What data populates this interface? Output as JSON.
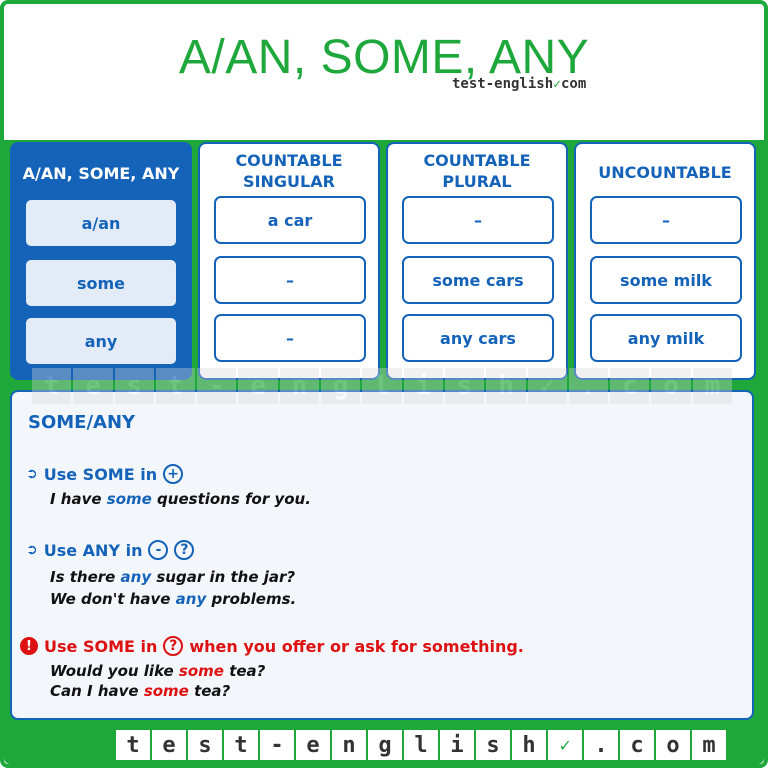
{
  "title": "A/AN, SOME, ANY",
  "brand": {
    "text": "test-english",
    "suffix": "com",
    "check_icon": "check-icon"
  },
  "grid": {
    "main_header": "A/AN, SOME, ANY",
    "row_labels": [
      "a/an",
      "some",
      "any"
    ],
    "columns": [
      {
        "header_line1": "COUNTABLE",
        "header_line2": "SINGULAR",
        "cells": [
          "a car",
          "–",
          "–"
        ]
      },
      {
        "header_line1": "COUNTABLE",
        "header_line2": "PLURAL",
        "cells": [
          "–",
          "some cars",
          "any cars"
        ]
      },
      {
        "header_line1": "UNCOUNTABLE",
        "header_line2": "",
        "cells": [
          "–",
          "some milk",
          "any milk"
        ]
      }
    ]
  },
  "panel": {
    "title": "SOME/ANY",
    "rule1": {
      "text": "Use SOME in",
      "symbols": [
        "+"
      ]
    },
    "rule1_example": {
      "pre": "I have ",
      "hl": "some",
      "post": " questions for you."
    },
    "rule2": {
      "text": "Use ANY in",
      "symbols": [
        "-",
        "?"
      ]
    },
    "rule2_examples": [
      {
        "pre": "Is there ",
        "hl": "any",
        "post": " sugar in the jar?"
      },
      {
        "pre": "We don't have ",
        "hl": "any",
        "post": " problems."
      }
    ],
    "rule3": {
      "pre": "Use SOME in",
      "symbol": "?",
      "post": "when you offer or ask for something."
    },
    "rule3_examples": [
      {
        "pre": "Would you like ",
        "hl": "some",
        "post": " tea?"
      },
      {
        "pre": "Can I have ",
        "hl": "some",
        "post": " tea?"
      }
    ]
  },
  "watermark_letters": [
    "t",
    "e",
    "s",
    "t",
    "-",
    "e",
    "n",
    "g",
    "l",
    "i",
    "s",
    "h",
    "✓",
    ".",
    "c",
    "o",
    "m"
  ],
  "brand_strip_letters": [
    "t",
    "e",
    "s",
    "t",
    "-",
    "e",
    "n",
    "g",
    "l",
    "i",
    "s",
    "h",
    "✓",
    ".",
    "c",
    "o",
    "m"
  ],
  "colors": {
    "green": "#1ea83c",
    "blue": "#1463b8",
    "red": "#dd1111"
  }
}
